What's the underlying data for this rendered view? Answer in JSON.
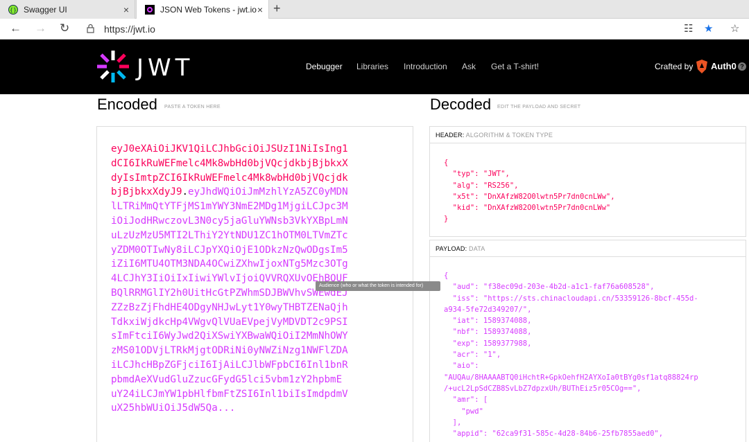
{
  "browser": {
    "tabs": [
      {
        "title": "Swagger UI",
        "close": "×"
      },
      {
        "title": "JSON Web Tokens - jwt.io",
        "close": "×"
      }
    ],
    "new_tab": "+",
    "url": "https://jwt.io"
  },
  "site": {
    "logo_text": "JWT",
    "nav": [
      "Debugger",
      "Libraries",
      "Introduction",
      "Ask",
      "Get a T-shirt!"
    ],
    "crafted_by": "Crafted by",
    "brand": "Auth0",
    "help": "?"
  },
  "encoded": {
    "title": "Encoded",
    "subtitle": "PASTE A TOKEN HERE",
    "token_header": "eyJ0eXAiOiJKV1QiLCJhbGciOiJSUzI1NiIsIng1\ndCI6IkRuWEFmelc4Mk8wbHd0bjVQcjdkbjBjbkxX\ndyIsImtpZCI6IkRuWEFmelc4Mk8wbHd0bjVQcjdk\nbjBjbkxXdyJ9",
    "dot": ".",
    "token_payload": "eyJhdWQiOiJmMzhlYzA5ZC0yMDN\nlLTRiMmQtYTFjMS1mYWY3NmE2MDg1MjgiLCJpc3M\niOiJodHRwczovL3N0cy5jaGluYWNsb3VkYXBpLmN\nuLzUzMzU5MTI2LThiY2YtNDU1ZC1hOTM0LTVmZTc\nyZDM0OTIwNy8iLCJpYXQiOjE1ODkzNzQwODgsIm5\niZiI6MTU4OTM3NDA4OCwiZXhwIjoxNTg5Mzc3OTg\n4LCJhY3IiOiIxIiwiYWlvIjoiQVVRQXUvOEhBQUF\nBQlRRMGlIY2h0UitHcGtPZWhmSDJBWVhvSWEwdEJ\nZZzBzZjFhdHE4ODgyNHJwLyt1Y0wyTHBTZENaQjh\nTdkxiWjdkcHp4VWgvQlVUaEVpejVyMDVDT2c9PSI\nsImFtciI6WyJwd2QiXSwiYXBwaWQiOiI2MmNhOWY\nzMS01ODVjLTRkMjgtODRiNi0yNWZiNzg1NWFlZDA\niLCJhcHBpZGFjciI6IjAiLCJlbWFpbCI6Inl1bnR\npbmdAeXVudGluZzucGFydG5lci5vbm1zY2hpbmE\nuY24iLCJmYW1pbHlfbmFtZSI6Inl1biIsImdpdmV\nuX25hbWUiOiJ5dW5Qa..."
  },
  "decoded": {
    "title": "Decoded",
    "subtitle": "EDIT THE PAYLOAD AND SECRET",
    "header_label": "HEADER:",
    "header_sub": "ALGORITHM & TOKEN TYPE",
    "header_json": "{\n  \"typ\": \"JWT\",\n  \"alg\": \"RS256\",\n  \"x5t\": \"DnXAfzW82O0lwtn5Pr7dn0cnLWw\",\n  \"kid\": \"DnXAfzW82O0lwtn5Pr7dn0cnLWw\"\n}",
    "payload_label": "PAYLOAD:",
    "payload_sub": "DATA",
    "payload_json": "{\n  \"aud\": \"f38ec09d-203e-4b2d-a1c1-faf76a608528\",\n  \"iss\": \"https://sts.chinacloudapi.cn/53359126-8bcf-455d-\na934-5fe72d349207/\",\n  \"iat\": 1589374088,\n  \"nbf\": 1589374088,\n  \"exp\": 1589377988,\n  \"acr\": \"1\",\n  \"aio\":\n\"AUQAu/8HAAAABTQ0iHchtR+GpkOehfH2AYXoIa0tBYg0sf1atq88824rp\n/+ucL2LpSdCZB8SvLbZ7dpzxUh/BUThEiz5r05COg==\",\n  \"amr\": [\n    \"pwd\"\n  ],\n  \"appid\": \"62ca9f31-585c-4d28-84b6-25fb7855aed0\","
  },
  "tooltip": "Audience (who or what the token is intended for)",
  "colors": {
    "header": "#fb015b",
    "payload": "#d63aff",
    "nav_bg": "#000000"
  }
}
